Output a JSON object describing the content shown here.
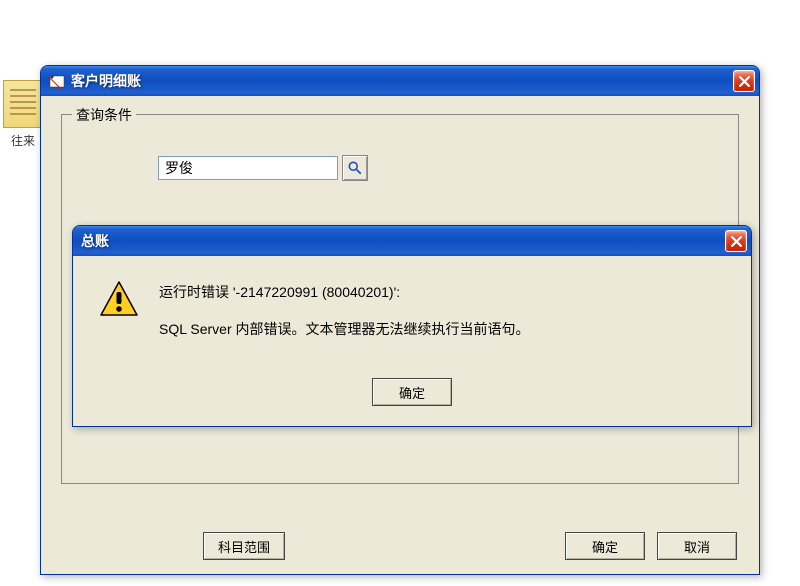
{
  "desktop": {
    "icon_label": "往来"
  },
  "main_window": {
    "title": "客户明细账",
    "group_label": "查询条件",
    "search_value": "罗俊",
    "buttons": {
      "scope": "科目范围",
      "ok": "确定",
      "cancel": "取消"
    }
  },
  "error_dialog": {
    "title": "总账",
    "line1": "运行时错误 '-2147220991 (80040201)':",
    "line2": "SQL Server 内部错误。文本管理器无法继续执行当前语句。",
    "ok": "确定"
  }
}
